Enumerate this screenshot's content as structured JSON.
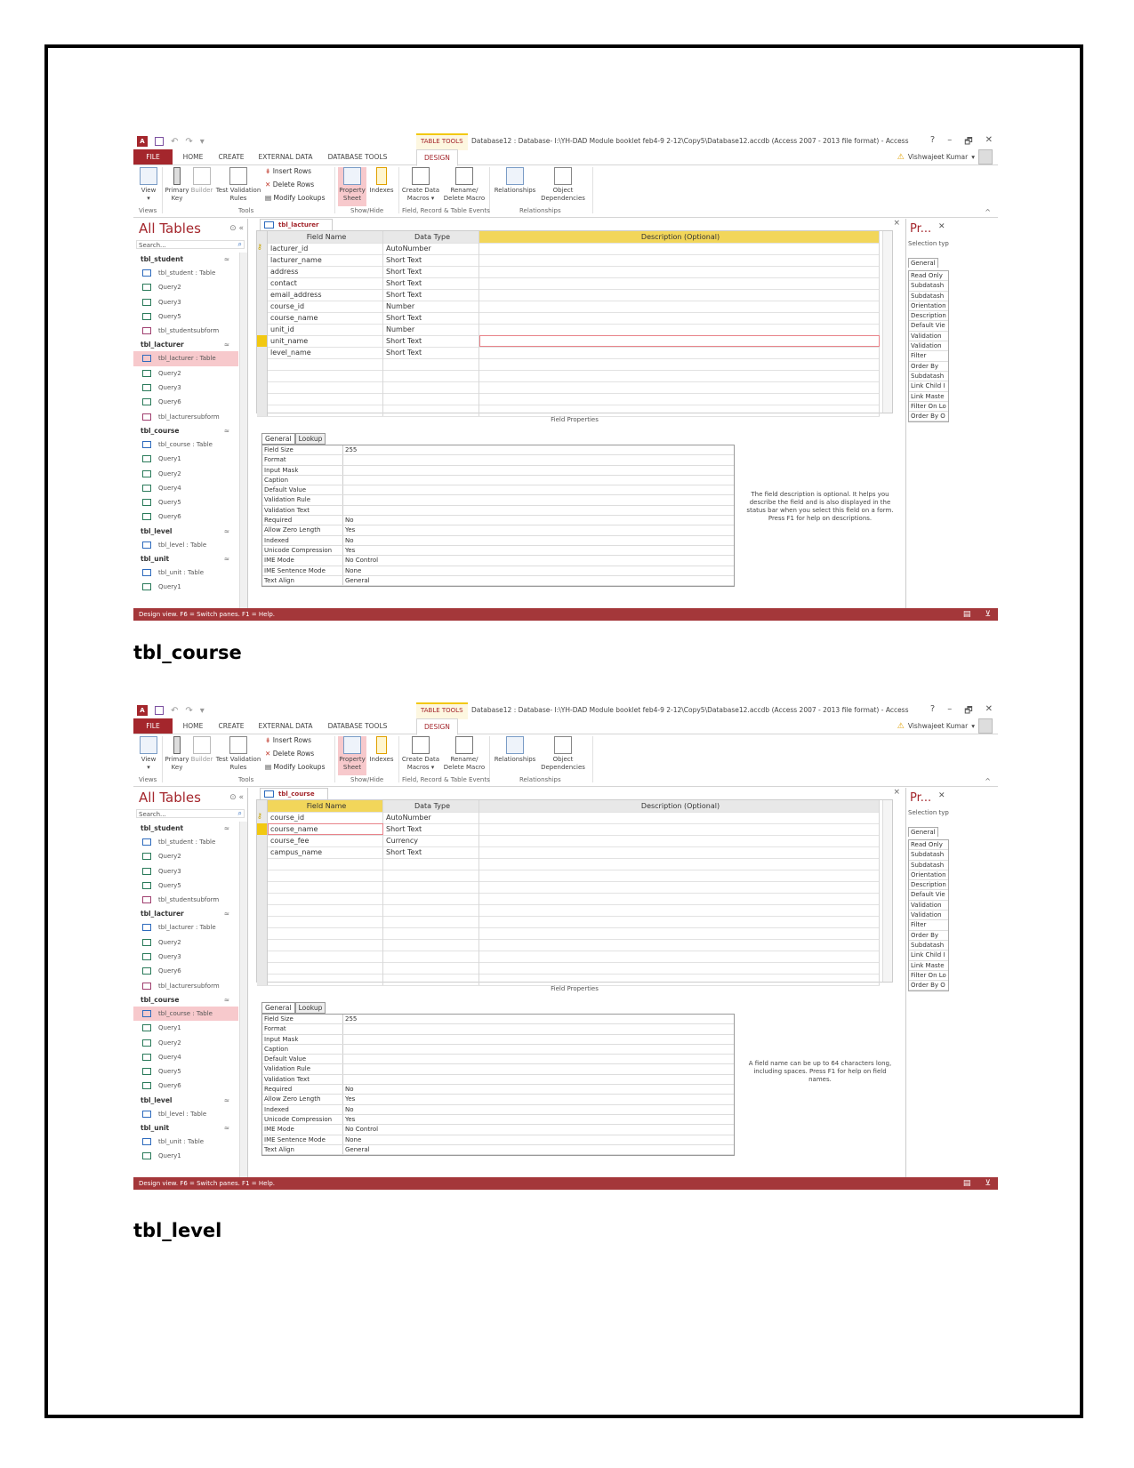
{
  "headings": [
    "tbl_course",
    "tbl_level"
  ],
  "app": {
    "window_title": "Database12 : Database- I:\\YH-DAD Module booklet feb4-9 2-12\\Copy5\\Database12.accdb (Access 2007 - 2013 file format) - Access",
    "contextual_tab_group": "TABLE TOOLS",
    "window_controls": [
      "?",
      "–",
      "🗗",
      "✕"
    ],
    "tabs": [
      "FILE",
      "HOME",
      "CREATE",
      "EXTERNAL DATA",
      "DATABASE TOOLS",
      "DESIGN"
    ],
    "user_name": "Vishwajeet Kumar",
    "ribbon": {
      "view": "View",
      "primary_key": "Primary Key",
      "builder": "Builder",
      "test_validation": "Test Validation Rules",
      "insert_rows": "Insert Rows",
      "delete_rows": "Delete Rows",
      "modify_lookups": "Modify Lookups",
      "property_sheet": "Property Sheet",
      "indexes": "Indexes",
      "create_data_macros": "Create Data Macros ▾",
      "rename_delete_macro": "Rename/ Delete Macro",
      "relationships": "Relationships",
      "object_dependencies": "Object Dependencies",
      "groups": [
        "Views",
        "Tools",
        "Show/Hide",
        "Field, Record & Table Events",
        "Relationships"
      ]
    },
    "nav": {
      "title": "All Tables",
      "search_placeholder": "Search...",
      "groups": [
        {
          "name": "tbl_student",
          "items": [
            {
              "label": "tbl_student : Table",
              "type": "table"
            },
            {
              "label": "Query2",
              "type": "query"
            },
            {
              "label": "Query3",
              "type": "query"
            },
            {
              "label": "Query5",
              "type": "query"
            },
            {
              "label": "tbl_studentsubform",
              "type": "form"
            }
          ]
        },
        {
          "name": "tbl_lacturer",
          "items": [
            {
              "label": "tbl_lacturer : Table",
              "type": "table"
            },
            {
              "label": "Query2",
              "type": "query"
            },
            {
              "label": "Query3",
              "type": "query"
            },
            {
              "label": "Query6",
              "type": "query"
            },
            {
              "label": "tbl_lacturersubform",
              "type": "form"
            }
          ]
        },
        {
          "name": "tbl_course",
          "items": [
            {
              "label": "tbl_course : Table",
              "type": "table"
            },
            {
              "label": "Query1",
              "type": "query"
            },
            {
              "label": "Query2",
              "type": "query"
            },
            {
              "label": "Query4",
              "type": "query"
            },
            {
              "label": "Query5",
              "type": "query"
            },
            {
              "label": "Query6",
              "type": "query"
            }
          ]
        },
        {
          "name": "tbl_level",
          "items": [
            {
              "label": "tbl_level : Table",
              "type": "table"
            }
          ]
        },
        {
          "name": "tbl_unit",
          "items": [
            {
              "label": "tbl_unit : Table",
              "type": "table"
            },
            {
              "label": "Query1",
              "type": "query"
            }
          ]
        }
      ]
    },
    "grid_headers": [
      "Field Name",
      "Data Type",
      "Description (Optional)"
    ],
    "field_properties_label": "Field Properties",
    "fp_tabs": [
      "General",
      "Lookup"
    ],
    "field_properties": [
      {
        "k": "Field Size",
        "v": "255"
      },
      {
        "k": "Format",
        "v": ""
      },
      {
        "k": "Input Mask",
        "v": ""
      },
      {
        "k": "Caption",
        "v": ""
      },
      {
        "k": "Default Value",
        "v": ""
      },
      {
        "k": "Validation Rule",
        "v": ""
      },
      {
        "k": "Validation Text",
        "v": ""
      },
      {
        "k": "Required",
        "v": "No"
      },
      {
        "k": "Allow Zero Length",
        "v": "Yes"
      },
      {
        "k": "Indexed",
        "v": "No"
      },
      {
        "k": "Unicode Compression",
        "v": "Yes"
      },
      {
        "k": "IME Mode",
        "v": "No Control"
      },
      {
        "k": "IME Sentence Mode",
        "v": "None"
      },
      {
        "k": "Text Align",
        "v": "General"
      }
    ],
    "property_sheet": {
      "title": "Pr...",
      "selection_type": "Selection typ",
      "tab": "General",
      "items": [
        "Read Only",
        "Subdatash",
        "Subdatash",
        "Orientation",
        "Description",
        "Default Vie",
        "Validation",
        "Validation",
        "Filter",
        "Order By",
        "Subdatash",
        "Link Child I",
        "Link Maste",
        "Filter On Lo",
        "Order By O"
      ]
    },
    "status_text": "Design view.  F6 = Switch panes.  F1 = Help."
  },
  "screens": [
    {
      "doc_tab": "tbl_lacturer",
      "selected_nav": "tbl_lacturer : Table",
      "help_text": "The field description is optional. It helps you describe the field and is also displayed in the status bar when you select this field on a form. Press F1 for help on descriptions.",
      "fields": [
        {
          "name": "lacturer_id",
          "type": "AutoNumber",
          "key": true
        },
        {
          "name": "lacturer_name",
          "type": "Short Text"
        },
        {
          "name": "address",
          "type": "Short Text"
        },
        {
          "name": "contact",
          "type": "Short Text"
        },
        {
          "name": "email_address",
          "type": "Short Text"
        },
        {
          "name": "course_id",
          "type": "Number"
        },
        {
          "name": "course_name",
          "type": "Short Text"
        },
        {
          "name": "unit_id",
          "type": "Number"
        },
        {
          "name": "unit_name",
          "type": "Short Text",
          "current": true
        },
        {
          "name": "level_name",
          "type": "Short Text"
        }
      ]
    },
    {
      "doc_tab": "tbl_course",
      "selected_nav": "tbl_course : Table",
      "help_text": "A field name can be up to 64 characters long, including spaces. Press F1 for help on field names.",
      "fields": [
        {
          "name": "course_id",
          "type": "AutoNumber",
          "key": true
        },
        {
          "name": "course_name",
          "type": "Short Text",
          "current": true
        },
        {
          "name": "course_fee",
          "type": "Currency"
        },
        {
          "name": "campus_name",
          "type": "Short Text"
        }
      ]
    }
  ]
}
